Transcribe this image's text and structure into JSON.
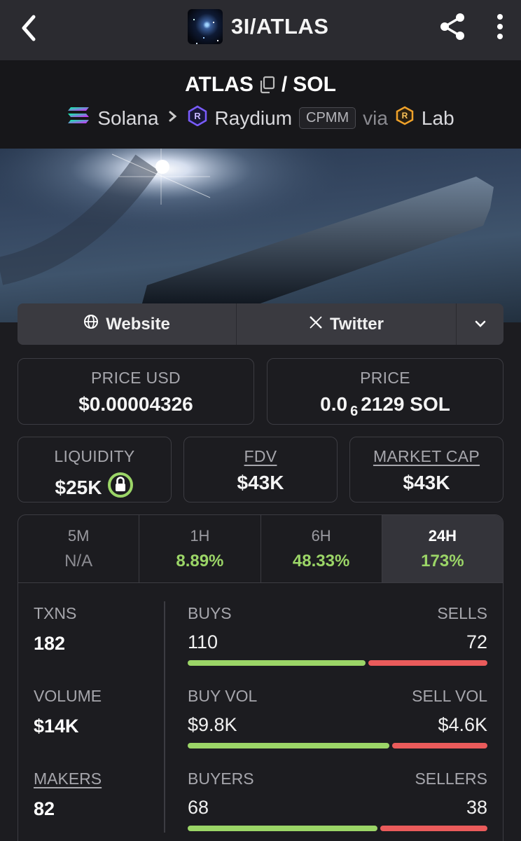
{
  "header": {
    "title": "3I/ATLAS"
  },
  "pair": {
    "base": "ATLAS",
    "separator": "/",
    "quote": "SOL",
    "chain": "Solana",
    "dex": "Raydium",
    "pool_type": "CPMM",
    "via": "via",
    "via_source": "Lab"
  },
  "links": {
    "website": "Website",
    "twitter": "Twitter"
  },
  "price_usd": {
    "label": "PRICE USD",
    "value": "$0.00004326"
  },
  "price": {
    "label": "PRICE",
    "prefix": "0.0",
    "zeros": "6",
    "digits": "2129 SOL"
  },
  "liquidity": {
    "label": "LIQUIDITY",
    "value": "$25K"
  },
  "fdv": {
    "label": "FDV",
    "value": "$43K"
  },
  "market_cap": {
    "label": "MARKET CAP",
    "value": "$43K"
  },
  "timeframes": [
    {
      "label": "5M",
      "change": "N/A"
    },
    {
      "label": "1H",
      "change": "8.89%"
    },
    {
      "label": "6H",
      "change": "48.33%"
    },
    {
      "label": "24H",
      "change": "173%"
    }
  ],
  "stats": {
    "txns": {
      "label": "TXNS",
      "value": "182"
    },
    "volume": {
      "label": "VOLUME",
      "value": "$14K"
    },
    "makers": {
      "label": "MAKERS",
      "value": "82"
    },
    "buys": {
      "label": "BUYS",
      "value": "110"
    },
    "sells": {
      "label": "SELLS",
      "value": "72"
    },
    "buy_vol": {
      "label": "BUY VOL",
      "value": "$9.8K"
    },
    "sell_vol": {
      "label": "SELL VOL",
      "value": "$4.6K"
    },
    "buyers": {
      "label": "BUYERS",
      "value": "68"
    },
    "sellers": {
      "label": "SELLERS",
      "value": "38"
    }
  },
  "ratios": {
    "buys_share": 0.6,
    "buy_vol_share": 0.68,
    "buyers_share": 0.64
  },
  "colors": {
    "positive": "#9bd567",
    "negative": "#ea5b5b",
    "background": "#1c1c20"
  },
  "icons": [
    "back-arrow-icon",
    "share-icon",
    "more-vertical-icon",
    "copy-icon",
    "solana-icon",
    "chevron-right-icon",
    "raydium-icon",
    "lab-icon",
    "globe-icon",
    "x-logo-icon",
    "chevron-down-icon",
    "lock-icon"
  ]
}
